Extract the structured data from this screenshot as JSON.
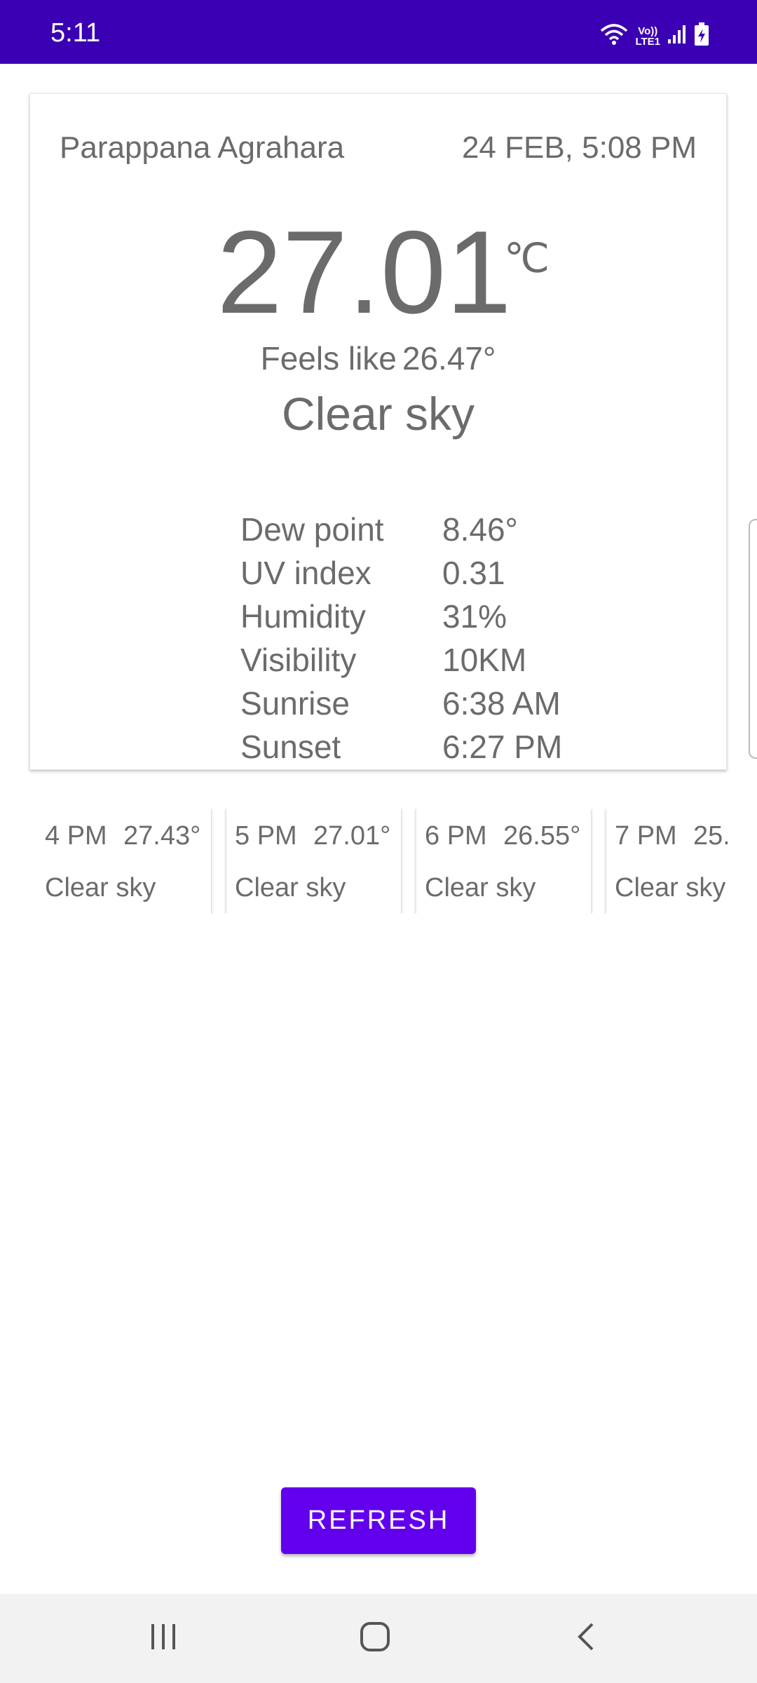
{
  "status_bar": {
    "time": "5:11",
    "icons": [
      "wifi-icon",
      "volte-icon",
      "signal-icon",
      "battery-charging-icon"
    ],
    "volte_label_top": "Vo))",
    "volte_label_bottom": "LTE1",
    "background": "#3b00b3"
  },
  "current": {
    "location": "Parappana Agrahara",
    "datetime": "24 FEB, 5:08 PM",
    "temperature": "27.01",
    "unit": "℃",
    "feels_like_label": "Feels like",
    "feels_like_value": "26.47°",
    "condition": "Clear sky",
    "details": [
      {
        "label": "Dew point",
        "value": "8.46°"
      },
      {
        "label": "UV index",
        "value": "0.31"
      },
      {
        "label": "Humidity",
        "value": "31%"
      },
      {
        "label": "Visibility",
        "value": "10KM"
      },
      {
        "label": "Sunrise",
        "value": "6:38 AM"
      },
      {
        "label": "Sunset",
        "value": "6:27 PM"
      }
    ]
  },
  "hourly": [
    {
      "time": "4 PM",
      "temp": "27.43°",
      "condition": "Clear sky"
    },
    {
      "time": "5 PM",
      "temp": "27.01°",
      "condition": "Clear sky"
    },
    {
      "time": "6 PM",
      "temp": "26.55°",
      "condition": "Clear sky"
    },
    {
      "time": "7 PM",
      "temp": "25.",
      "condition": "Clear sky"
    }
  ],
  "refresh": {
    "label": "REFRESH",
    "color": "#6200ee"
  },
  "nav_bar": {
    "icons": [
      "recent-apps-icon",
      "home-icon",
      "back-icon"
    ]
  }
}
